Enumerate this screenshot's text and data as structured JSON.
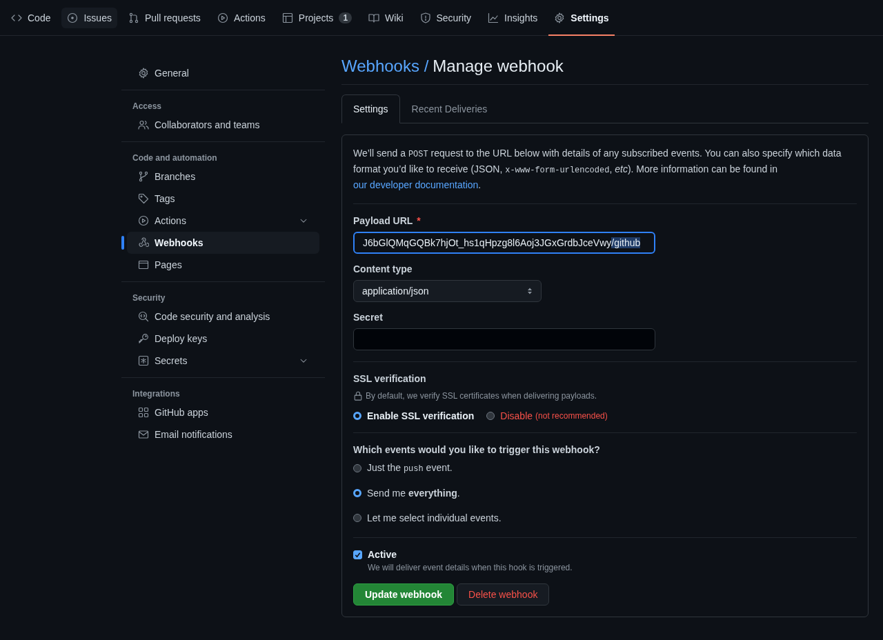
{
  "repo_nav": [
    {
      "label": "Code",
      "kind": "code",
      "selected": false,
      "hovered": false
    },
    {
      "label": "Issues",
      "kind": "issue",
      "selected": false,
      "hovered": true
    },
    {
      "label": "Pull requests",
      "kind": "pr",
      "selected": false,
      "hovered": false
    },
    {
      "label": "Actions",
      "kind": "play",
      "selected": false,
      "hovered": false
    },
    {
      "label": "Projects",
      "kind": "table",
      "selected": false,
      "hovered": false,
      "count": "1"
    },
    {
      "label": "Wiki",
      "kind": "book",
      "selected": false,
      "hovered": false
    },
    {
      "label": "Security",
      "kind": "shield",
      "selected": false,
      "hovered": false
    },
    {
      "label": "Insights",
      "kind": "graph",
      "selected": false,
      "hovered": false
    },
    {
      "label": "Settings",
      "kind": "gear",
      "selected": true,
      "hovered": false
    }
  ],
  "sidebar": {
    "groups": [
      {
        "items": [
          {
            "label": "General",
            "kind": "gear",
            "selected": false,
            "expandable": false
          }
        ]
      },
      {
        "heading": "Access",
        "items": [
          {
            "label": "Collaborators and teams",
            "kind": "people",
            "selected": false,
            "expandable": false
          }
        ]
      },
      {
        "heading": "Code and automation",
        "items": [
          {
            "label": "Branches",
            "kind": "branch",
            "selected": false,
            "expandable": false
          },
          {
            "label": "Tags",
            "kind": "tag",
            "selected": false,
            "expandable": false
          },
          {
            "label": "Actions",
            "kind": "play",
            "selected": false,
            "expandable": true
          },
          {
            "label": "Webhooks",
            "kind": "webhook",
            "selected": true,
            "expandable": false
          },
          {
            "label": "Pages",
            "kind": "browser",
            "selected": false,
            "expandable": false
          }
        ]
      },
      {
        "heading": "Security",
        "items": [
          {
            "label": "Code security and analysis",
            "kind": "codescan",
            "selected": false,
            "expandable": false
          },
          {
            "label": "Deploy keys",
            "kind": "key",
            "selected": false,
            "expandable": false
          },
          {
            "label": "Secrets",
            "kind": "asterisk",
            "selected": false,
            "expandable": true
          }
        ]
      },
      {
        "heading": "Integrations",
        "items": [
          {
            "label": "GitHub apps",
            "kind": "apps",
            "selected": false,
            "expandable": false
          },
          {
            "label": "Email notifications",
            "kind": "mail",
            "selected": false,
            "expandable": false
          }
        ]
      }
    ]
  },
  "breadcrumb": {
    "parent": "Webhooks /",
    "current": "Manage webhook"
  },
  "tabs": [
    {
      "label": "Settings",
      "selected": true
    },
    {
      "label": "Recent Deliveries",
      "selected": false
    }
  ],
  "intro": [
    {
      "kind": "text",
      "text": "We’ll send a "
    },
    {
      "kind": "code",
      "text": "POST"
    },
    {
      "kind": "text",
      "text": " request to the URL below with details of any subscribed events. You can also specify which data format you’d like to receive (JSON, "
    },
    {
      "kind": "code",
      "text": "x-www-form-urlencoded"
    },
    {
      "kind": "text",
      "text": ", "
    },
    {
      "kind": "em",
      "text": "etc"
    },
    {
      "kind": "text",
      "text": "). More information can be found in "
    },
    {
      "kind": "link",
      "text": "our developer documentation"
    },
    {
      "kind": "text",
      "text": "."
    }
  ],
  "payload_url": {
    "label": "Payload URL",
    "required_mark": "*",
    "value": "J6bGlQMqGQBk7hjOt_hs1qHpzg8l6Aoj3JGxGrdbJceVwy",
    "selected_text": "/github"
  },
  "content_type": {
    "label": "Content type",
    "value": "application/json"
  },
  "secret": {
    "label": "Secret"
  },
  "ssl": {
    "title": "SSL verification",
    "note": "By default, we verify SSL certificates when delivering payloads.",
    "options": [
      {
        "label": "Enable SSL verification",
        "kind": "normal",
        "selected": true
      },
      {
        "label": "Disable",
        "hint": "(not recommended)",
        "kind": "danger",
        "selected": false
      }
    ]
  },
  "events": {
    "title": "Which events would you like to trigger this webhook?",
    "options": [
      {
        "parts": [
          {
            "kind": "text",
            "text": "Just the "
          },
          {
            "kind": "code",
            "text": "push"
          },
          {
            "kind": "text",
            "text": " event."
          }
        ],
        "selected": false
      },
      {
        "parts": [
          {
            "kind": "text",
            "text": "Send me "
          },
          {
            "kind": "bold",
            "text": "everything"
          },
          {
            "kind": "text",
            "text": "."
          }
        ],
        "selected": true
      },
      {
        "parts": [
          {
            "kind": "text",
            "text": "Let me select individual events."
          }
        ],
        "selected": false
      }
    ]
  },
  "active": {
    "label": "Active",
    "checked": true,
    "description": "We will deliver event details when this hook is triggered."
  },
  "buttons": [
    {
      "label": "Update webhook",
      "kind": "primary"
    },
    {
      "label": "Delete webhook",
      "kind": "danger"
    }
  ]
}
